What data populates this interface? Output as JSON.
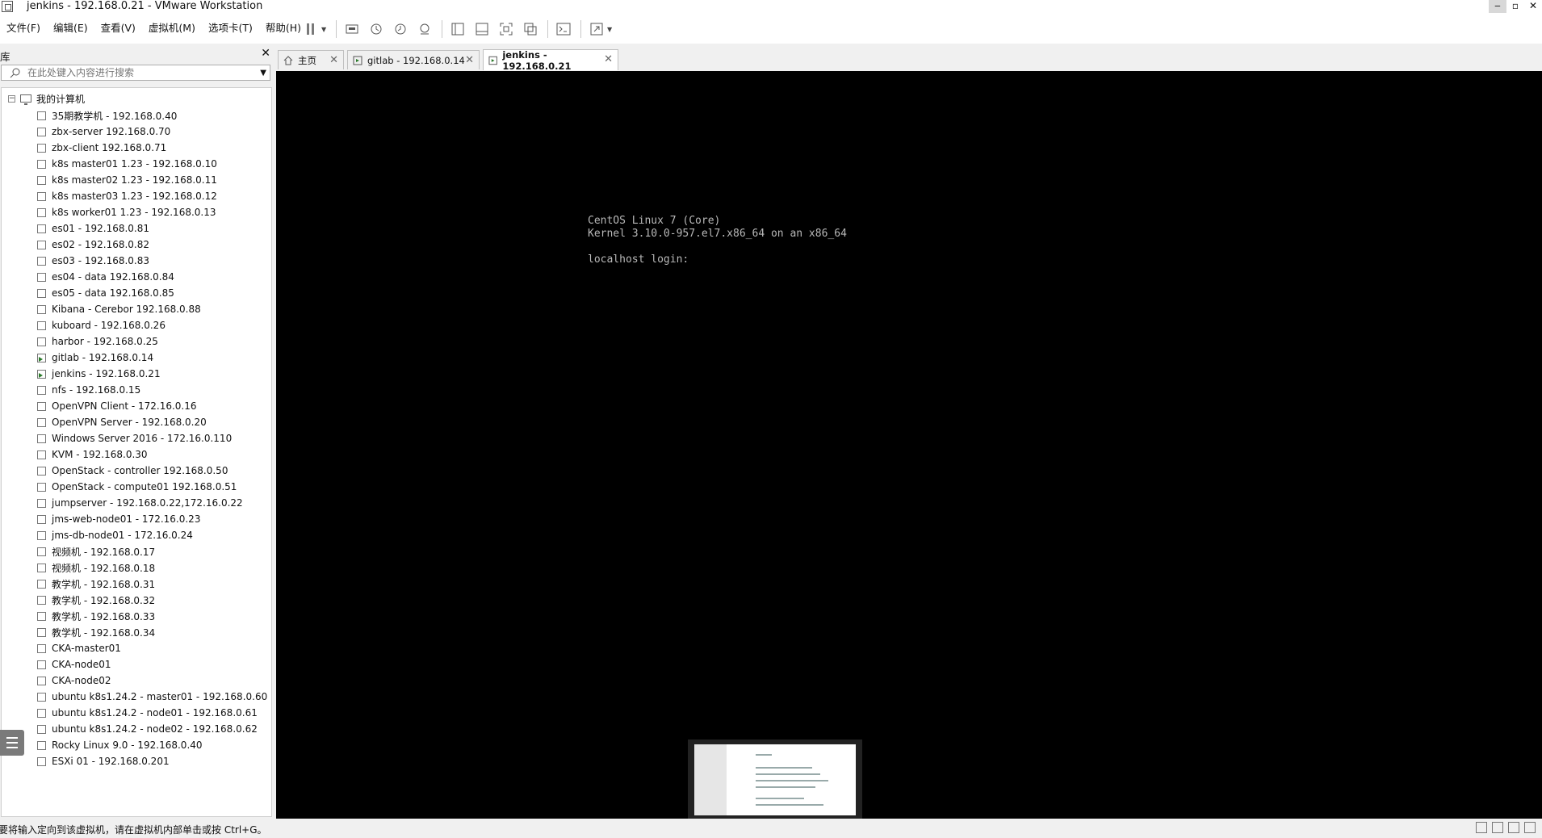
{
  "window": {
    "title": "jenkins - 192.168.0.21 - VMware Workstation",
    "minimize": "‒",
    "maximize": "▫",
    "close": "✕"
  },
  "menu": [
    "文件(F)",
    "编辑(E)",
    "查看(V)",
    "虚拟机(M)",
    "选项卡(T)",
    "帮助(H)"
  ],
  "toolbar": {
    "icons": [
      "pause-icon",
      "send-keys-icon",
      "snapshot-icon",
      "revert-snapshot-icon",
      "snapshot-manager-icon",
      "library-view-icon",
      "thumbnail-view-icon",
      "full-screen-icon",
      "unity-icon",
      "console-icon",
      "stretch-icon"
    ]
  },
  "library": {
    "title": "库",
    "close": "✕",
    "search_placeholder": "在此处键入内容进行搜索",
    "root": "我的计算机",
    "items": [
      {
        "label": "35期教学机 - 192.168.0.40",
        "running": false
      },
      {
        "label": "zbx-server 192.168.0.70",
        "running": false
      },
      {
        "label": "zbx-client  192.168.0.71",
        "running": false
      },
      {
        "label": "k8s master01 1.23 - 192.168.0.10",
        "running": false
      },
      {
        "label": "k8s master02 1.23 - 192.168.0.11",
        "running": false
      },
      {
        "label": "k8s master03 1.23 - 192.168.0.12",
        "running": false
      },
      {
        "label": "k8s worker01 1.23 - 192.168.0.13",
        "running": false
      },
      {
        "label": "es01 - 192.168.0.81",
        "running": false
      },
      {
        "label": "es02 - 192.168.0.82",
        "running": false
      },
      {
        "label": "es03 - 192.168.0.83",
        "running": false
      },
      {
        "label": "es04 - data 192.168.0.84",
        "running": false
      },
      {
        "label": "es05 - data 192.168.0.85",
        "running": false
      },
      {
        "label": "Kibana - Cerebor 192.168.0.88",
        "running": false
      },
      {
        "label": "kuboard - 192.168.0.26",
        "running": false
      },
      {
        "label": "harbor - 192.168.0.25",
        "running": false
      },
      {
        "label": "gitlab - 192.168.0.14",
        "running": true
      },
      {
        "label": "jenkins - 192.168.0.21",
        "running": true
      },
      {
        "label": "nfs - 192.168.0.15",
        "running": false
      },
      {
        "label": "OpenVPN Client - 172.16.0.16",
        "running": false
      },
      {
        "label": "OpenVPN Server - 192.168.0.20",
        "running": false
      },
      {
        "label": "Windows Server 2016 - 172.16.0.110",
        "running": false
      },
      {
        "label": "KVM - 192.168.0.30",
        "running": false
      },
      {
        "label": "OpenStack - controller 192.168.0.50",
        "running": false
      },
      {
        "label": "OpenStack - compute01 192.168.0.51",
        "running": false
      },
      {
        "label": "jumpserver - 192.168.0.22,172.16.0.22",
        "running": false
      },
      {
        "label": "jms-web-node01 - 172.16.0.23",
        "running": false
      },
      {
        "label": "jms-db-node01 - 172.16.0.24",
        "running": false
      },
      {
        "label": "视频机 - 192.168.0.17",
        "running": false
      },
      {
        "label": "视频机 - 192.168.0.18",
        "running": false
      },
      {
        "label": "教学机 - 192.168.0.31",
        "running": false
      },
      {
        "label": "教学机 - 192.168.0.32",
        "running": false
      },
      {
        "label": "教学机 - 192.168.0.33",
        "running": false
      },
      {
        "label": "教学机 - 192.168.0.34",
        "running": false
      },
      {
        "label": "CKA-master01",
        "running": false
      },
      {
        "label": "CKA-node01",
        "running": false
      },
      {
        "label": "CKA-node02",
        "running": false
      },
      {
        "label": "ubuntu k8s1.24.2 - master01 - 192.168.0.60",
        "running": false
      },
      {
        "label": "ubuntu k8s1.24.2 - node01 - 192.168.0.61",
        "running": false
      },
      {
        "label": "ubuntu k8s1.24.2 - node02 - 192.168.0.62",
        "running": false
      },
      {
        "label": "Rocky Linux 9.0 - 192.168.0.40",
        "running": false
      },
      {
        "label": "ESXi 01 - 192.168.0.201",
        "running": false
      }
    ]
  },
  "tabs": [
    {
      "label": "主页",
      "active": false,
      "close": "✕"
    },
    {
      "label": "gitlab - 192.168.0.14",
      "active": false,
      "close": "✕"
    },
    {
      "label": "jenkins - 192.168.0.21",
      "active": true,
      "close": "✕"
    }
  ],
  "console": {
    "line1": "CentOS Linux 7 (Core)",
    "line2": "Kernel 3.10.0-957.el7.x86_64 on an x86_64",
    "login": "localhost login:"
  },
  "statusbar": {
    "message": "要将输入定向到该虚拟机，请在虚拟机内部单击或按 Ctrl+G。"
  }
}
